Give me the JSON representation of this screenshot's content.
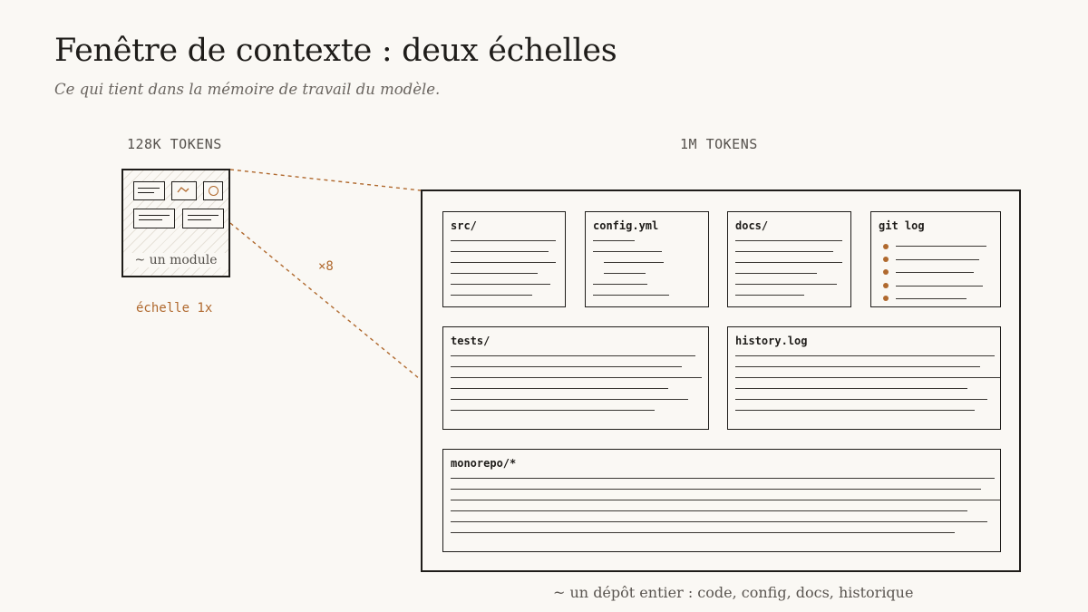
{
  "title": "Fenêtre de contexte : deux échelles",
  "subtitle": "Ce qui tient dans la mémoire de travail du modèle.",
  "small_window": {
    "label": "128K TOKENS",
    "caption": "~ un module",
    "scale": "échelle 1x"
  },
  "large_window": {
    "label": "1M TOKENS",
    "caption": "~ un dépôt entier : code, config, docs, historique",
    "panels": {
      "src": "src/",
      "config": "config.yml",
      "docs": "docs/",
      "git": "git log",
      "tests": "tests/",
      "history": "history.log",
      "monorepo": "monorepo/*"
    }
  },
  "multiplier": "×8",
  "colors": {
    "accent": "#b0692e",
    "ink": "#1f1d1a",
    "background": "#faf8f4",
    "muted": "#55514c"
  },
  "icons": [
    "chart-icon",
    "circle-icon"
  ]
}
